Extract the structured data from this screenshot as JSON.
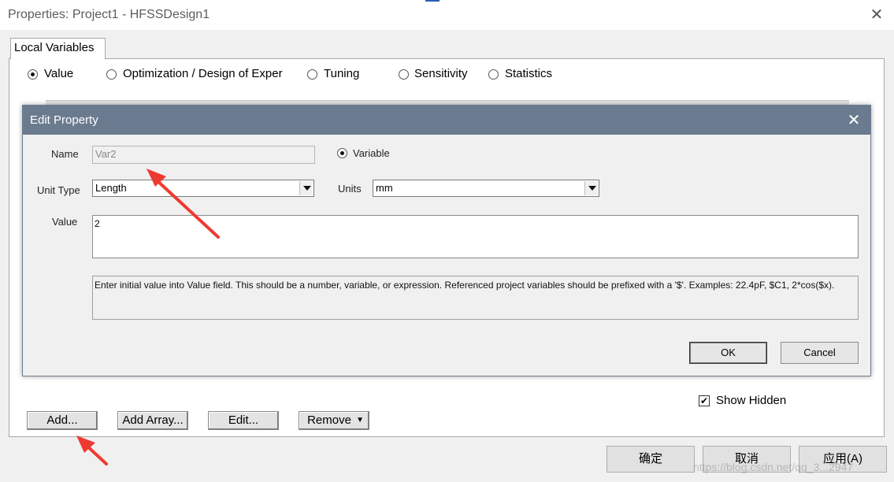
{
  "window": {
    "title": "Properties: Project1 - HFSSDesign1",
    "close_glyph": "✕"
  },
  "tabs": [
    {
      "label": "Local Variables",
      "active": true
    }
  ],
  "mode_radios": [
    {
      "label": "Value",
      "selected": true
    },
    {
      "label": "Optimization / Design of Exper",
      "selected": false
    },
    {
      "label": "Tuning",
      "selected": false
    },
    {
      "label": "Sensitivity",
      "selected": false
    },
    {
      "label": "Statistics",
      "selected": false
    }
  ],
  "edit_property": {
    "title": "Edit Property",
    "close_glyph": "✕",
    "name_label": "Name",
    "name_value": "Var2",
    "variable_radio_label": "Variable",
    "unit_type_label": "Unit Type",
    "unit_type_value": "Length",
    "units_label": "Units",
    "units_value": "mm",
    "value_label": "Value",
    "value": "2",
    "hint": "Enter initial value into Value field. This should be a number, variable, or expression. Referenced project variables should be prefixed with a '$'. Examples: 22.4pF, $C1, 2*cos($x).",
    "ok_label": "OK",
    "cancel_label": "Cancel"
  },
  "show_hidden": {
    "label": "Show Hidden",
    "checked": true,
    "check_glyph": "✔"
  },
  "panel_buttons": {
    "add": "Add...",
    "add_array": "Add Array...",
    "edit": "Edit...",
    "remove": "Remove",
    "remove_arrow": "▼"
  },
  "dialog_buttons": {
    "confirm": "确定",
    "cancel": "取消",
    "apply": "应用(A)"
  },
  "watermark": "https://blog.csdn.net/qq_3...2947",
  "annotation_color": "#ee3a32"
}
